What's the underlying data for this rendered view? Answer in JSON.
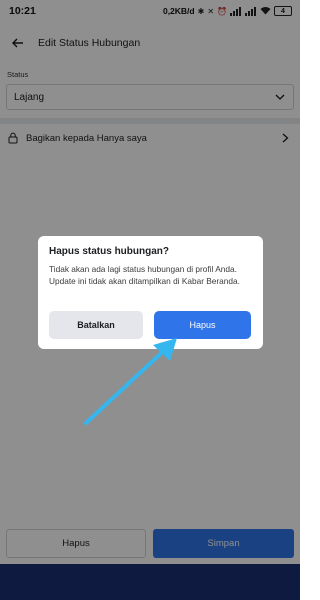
{
  "status_bar": {
    "time": "10:21",
    "network_speed": "0,2KB/d",
    "battery": "4"
  },
  "header": {
    "title": "Edit Status Hubungan"
  },
  "form": {
    "status_label": "Status",
    "status_value": "Lajang",
    "privacy_label": "Bagikan kepada Hanya saya"
  },
  "bottom_buttons": {
    "delete_label": "Hapus",
    "save_label": "Simpan"
  },
  "dialog": {
    "title": "Hapus status hubungan?",
    "message": "Tidak akan ada lagi status hubungan di profil Anda. Update ini tidak akan ditampilkan di Kabar Beranda.",
    "cancel_label": "Batalkan",
    "confirm_label": "Hapus"
  },
  "colors": {
    "primary_blue": "#2f74e8",
    "nav_bar": "#1c2f73",
    "annotation_arrow": "#35b6ee"
  }
}
